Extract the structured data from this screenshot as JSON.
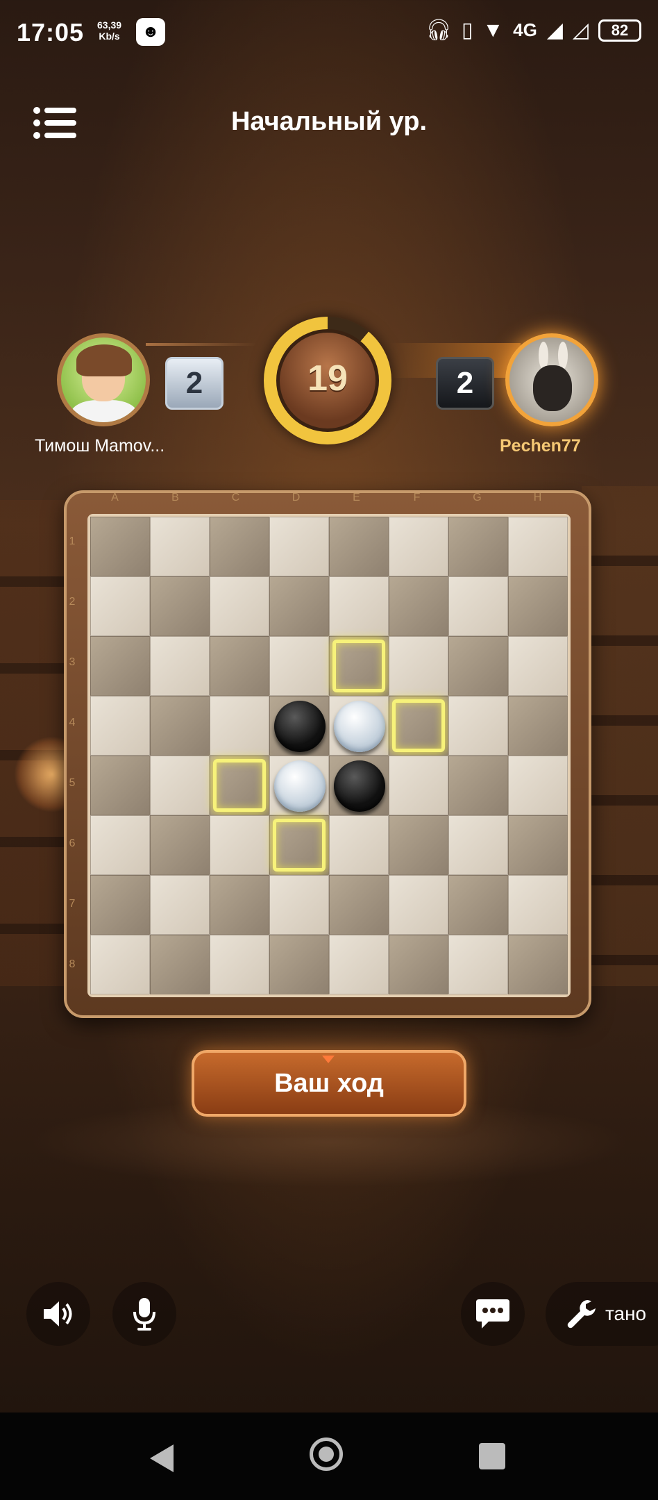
{
  "status_bar": {
    "time": "17:05",
    "net_speed_value": "63,39",
    "net_speed_unit": "Kb/s",
    "network": "4G",
    "battery": "82"
  },
  "header": {
    "title": "Начальный ур."
  },
  "players": {
    "left": {
      "name": "Тимош Mamov...",
      "score": "2",
      "piece": "white"
    },
    "right": {
      "name": "Pechen77",
      "score": "2",
      "piece": "black"
    }
  },
  "timer": {
    "seconds": "19"
  },
  "board": {
    "columns": [
      "A",
      "B",
      "C",
      "D",
      "E",
      "F",
      "G",
      "H"
    ],
    "rows": [
      "1",
      "2",
      "3",
      "4",
      "5",
      "6",
      "7",
      "8"
    ],
    "pieces": [
      {
        "cell": "D4",
        "color": "black"
      },
      {
        "cell": "E4",
        "color": "white"
      },
      {
        "cell": "D5",
        "color": "white"
      },
      {
        "cell": "E5",
        "color": "black"
      }
    ],
    "hints": [
      "E3",
      "F4",
      "C5",
      "D6"
    ]
  },
  "turn_button": {
    "label": "Ваш ход"
  },
  "controls": {
    "tool_label": "тано",
    "icons": [
      "speaker-icon",
      "microphone-icon",
      "chat-icon",
      "wrench-icon"
    ]
  },
  "colors": {
    "hint": "#f7f27a",
    "accent": "#f2a33a",
    "turn_button": "#c66a2c"
  }
}
